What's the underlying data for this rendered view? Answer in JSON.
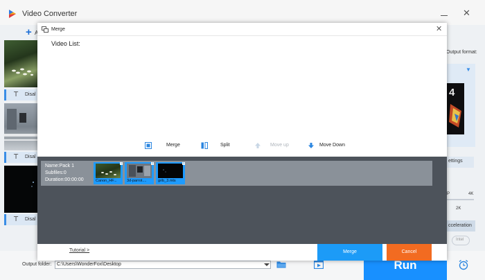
{
  "app": {
    "title": "Video Converter",
    "add_files_label": "A",
    "thumbnails": [
      {
        "label": "Disal"
      },
      {
        "label": "Disal"
      },
      {
        "label": "Disal"
      }
    ],
    "right_panel": {
      "output_format_label": "Output format:",
      "settings_label": "ettings",
      "quality_left": "P",
      "quality_right": "4K",
      "quality_mid": "2K",
      "acceleration_label": "cceleration",
      "intel_label": "Intel"
    },
    "bottom": {
      "output_folder_label": "Output folder:",
      "output_folder_value": "C:\\Users\\WonderFox\\Desktop",
      "run_label": "Run"
    }
  },
  "dialog": {
    "title": "Merge",
    "video_list_label": "Video List:",
    "actions": {
      "merge": "Merge",
      "split": "Split",
      "move_up": "Move up",
      "move_down": "Move Down"
    },
    "pack": {
      "name": "Name:Pack 1",
      "subfiles": "Subfiles:0",
      "duration": "Duration:00:00:00",
      "clips": [
        {
          "name": "Canon_HF...",
          "number": "1"
        },
        {
          "name": "3d-parrot....",
          "number": "2"
        },
        {
          "name": "grib_3.mts",
          "number": "3"
        }
      ]
    },
    "footer": {
      "tutorial": "Tutorial >",
      "merge_button": "Merge",
      "cancel_button": "Cancel"
    }
  },
  "colors": {
    "accent": "#1c9bf7",
    "cancel": "#f26b21",
    "run": "#1890ff",
    "pack_bg": "#4d535b",
    "pack_row": "#8a9199"
  }
}
